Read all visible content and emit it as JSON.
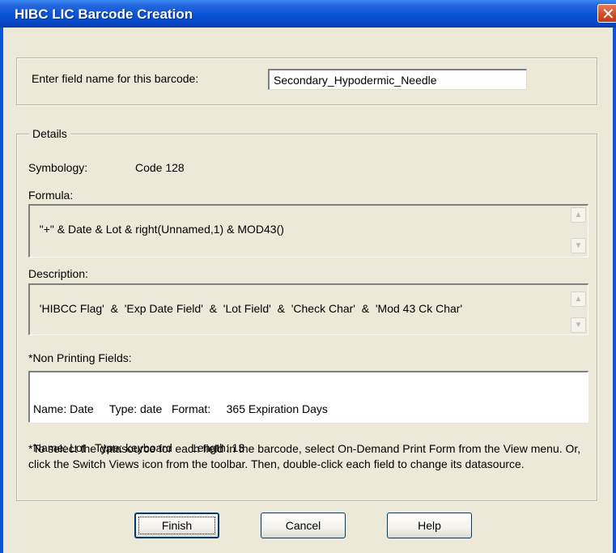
{
  "window": {
    "title": "HIBC LIC Barcode Creation",
    "close_glyph": "✕"
  },
  "field_name": {
    "label": "Enter field name for this barcode:",
    "value": "Secondary_Hypodermic_Needle"
  },
  "details": {
    "legend": "Details",
    "symbology_label": "Symbology:",
    "symbology_value": "Code 128",
    "formula_label": "Formula:",
    "formula_value": "\"+\" & Date & Lot & right(Unnamed,1) & MOD43()",
    "description_label": "Description:",
    "description_value": "'HIBCC Flag'  &  'Exp Date Field'  &  'Lot Field'  &  'Check Char'  &  'Mod 43 Ck Char'",
    "non_printing_label": "*Non Printing Fields:",
    "non_printing_lines": [
      "Name: Date     Type: date   Format:     365 Expiration Days",
      "Name: Lot   Type: keyboard      Length: 13"
    ],
    "note": "*To select the datasource for each field in the barcode, select On-Demand Print Form from the View menu.  Or, click the Switch Views icon from the toolbar.  Then, double-click each field to change its datasource."
  },
  "scroll": {
    "up_glyph": "▲",
    "down_glyph": "▼"
  },
  "buttons": {
    "finish": "Finish",
    "cancel": "Cancel",
    "help": "Help"
  }
}
